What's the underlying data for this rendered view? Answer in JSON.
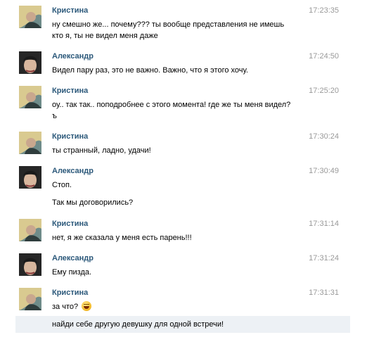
{
  "messages": [
    {
      "author": "Кристина",
      "avatar": "kristina-avatar",
      "time": "17:23:35",
      "lines": [
        "ну смешно же... почему??? ты вообще представления не имешь",
        "кто я, ты не видел меня даже"
      ]
    },
    {
      "author": "Александр",
      "avatar": "aleksandr-avatar",
      "time": "17:24:50",
      "lines": [
        "Видел пару раз, это не важно. Важно, что я этого хочу."
      ]
    },
    {
      "author": "Кристина",
      "avatar": "kristina-avatar",
      "time": "17:25:20",
      "lines": [
        "оу.. так так.. поподробнее с этого момента! где же ты меня видел?",
        "ъ"
      ]
    },
    {
      "author": "Кристина",
      "avatar": "kristina-avatar",
      "time": "17:30:24",
      "lines": [
        "ты странный, ладно, удачи!"
      ]
    },
    {
      "author": "Александр",
      "avatar": "aleksandr-avatar",
      "time": "17:30:49",
      "lines": [
        "Стоп.",
        "Так мы договорились?"
      ]
    },
    {
      "author": "Кристина",
      "avatar": "kristina-avatar",
      "time": "17:31:14",
      "lines": [
        "нет, я же сказала у меня есть парень!!!"
      ]
    },
    {
      "author": "Александр",
      "avatar": "aleksandr-avatar",
      "time": "17:31:24",
      "lines": [
        "Ему пизда."
      ]
    },
    {
      "author": "Кристина",
      "avatar": "kristina-avatar",
      "time": "17:31:31",
      "lines": [
        "за что?"
      ],
      "emoji": "laughing-smiley-icon"
    }
  ],
  "pending_message": "найди себе другую девушку для одной встречи!"
}
